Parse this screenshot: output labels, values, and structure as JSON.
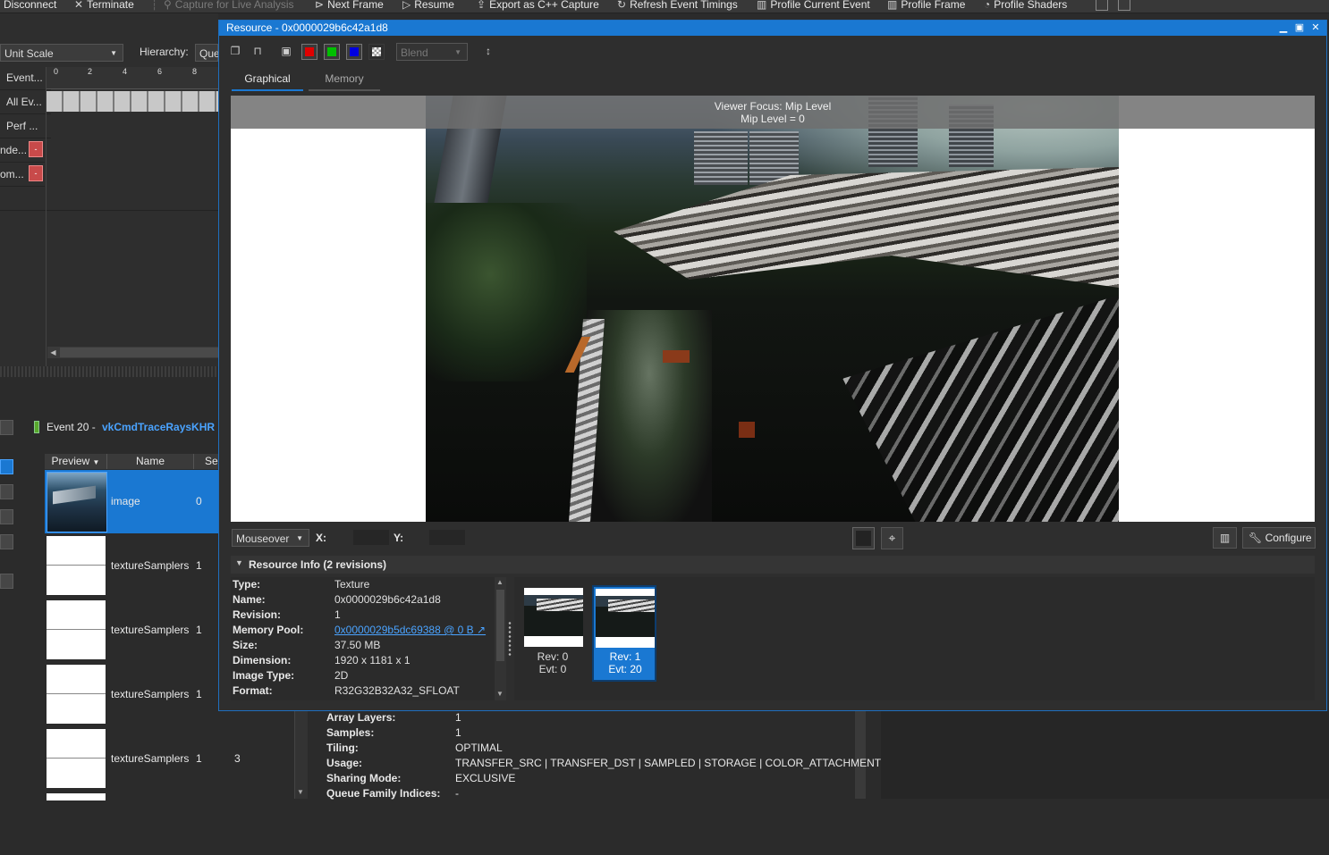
{
  "toolbar": {
    "disconnect": "Disconnect",
    "terminate": "Terminate",
    "capture_live": "Capture for Live Analysis",
    "next_frame": "Next Frame",
    "resume": "Resume",
    "export_cpp": "Export as C++ Capture",
    "refresh_timings": "Refresh Event Timings",
    "profile_current": "Profile Current Event",
    "profile_frame": "Profile Frame",
    "profile_shaders": "Profile Shaders"
  },
  "timeline": {
    "scale_select": "Unit Scale",
    "hierarchy_label": "Hierarchy:",
    "hierarchy_select": "Que",
    "ticks": [
      "0",
      "2",
      "4",
      "6",
      "8"
    ],
    "rows": [
      "Event...",
      "All Ev...",
      "Perf ...",
      "nde...",
      "om..."
    ],
    "collapse_btn": "-"
  },
  "event_bar": {
    "prefix": "Event 20 -",
    "name": "vkCmdTraceRaysKHR"
  },
  "bindings_table": {
    "headers": [
      "Preview",
      "Name",
      "Se"
    ],
    "rows": [
      {
        "name": "image",
        "set": "0",
        "binding": ""
      },
      {
        "name": "textureSamplers",
        "set": "1",
        "binding": ""
      },
      {
        "name": "textureSamplers",
        "set": "1",
        "binding": ""
      },
      {
        "name": "textureSamplers",
        "set": "1",
        "binding": ""
      },
      {
        "name": "textureSamplers",
        "set": "1",
        "binding": "3"
      }
    ]
  },
  "background_info": [
    {
      "label": "Array Layers:",
      "value": "1"
    },
    {
      "label": "Samples:",
      "value": "1"
    },
    {
      "label": "Tiling:",
      "value": "OPTIMAL"
    },
    {
      "label": "Usage:",
      "value": "TRANSFER_SRC | TRANSFER_DST | SAMPLED | STORAGE | COLOR_ATTACHMENT"
    },
    {
      "label": "Sharing Mode:",
      "value": "EXCLUSIVE"
    },
    {
      "label": "Queue Family Indices:",
      "value": "-"
    }
  ],
  "resource_window": {
    "title": "Resource - 0x0000029b6c42a1d8",
    "blend_select": "Blend",
    "tabs": [
      "Graphical",
      "Memory"
    ],
    "active_tab": "Graphical",
    "viewer_focus": "Viewer Focus: Mip Level",
    "mip_level": "Mip Level = 0",
    "mouse_mode": "Mouseover",
    "x_label": "X:",
    "y_label": "Y:",
    "configure": "Configure",
    "info_header": "Resource Info (2 revisions)",
    "info": [
      {
        "label": "Type:",
        "value": "Texture"
      },
      {
        "label": "Name:",
        "value": "0x0000029b6c42a1d8"
      },
      {
        "label": "Revision:",
        "value": "1"
      },
      {
        "label": "Memory Pool:",
        "value": "0x0000029b5dc69388 @ 0 B"
      },
      {
        "label": "Size:",
        "value": "37.50 MB"
      },
      {
        "label": "Dimension:",
        "value": "1920 x 1181 x 1"
      },
      {
        "label": "Image Type:",
        "value": "2D"
      },
      {
        "label": "Format:",
        "value": "R32G32B32A32_SFLOAT"
      }
    ],
    "revisions": [
      {
        "rev": "Rev: 0",
        "evt": "Evt: 0"
      },
      {
        "rev": "Rev: 1",
        "evt": "Evt: 20"
      }
    ],
    "selected_revision": 1
  },
  "colors": {
    "accent": "#1a78d2",
    "selection": "#1a78d2",
    "channel_red": "#e00000",
    "channel_green": "#00c000",
    "channel_blue": "#0000e0",
    "link": "#4aa3ff"
  }
}
